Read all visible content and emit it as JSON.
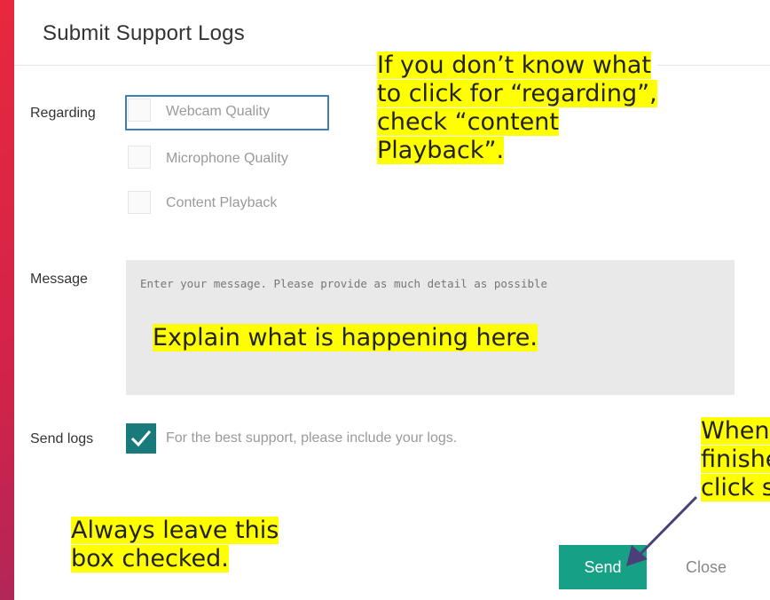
{
  "dialog": {
    "title": "Submit Support Logs",
    "regarding_label": "Regarding",
    "options": [
      {
        "label": "Webcam Quality",
        "checked": false,
        "focused": true
      },
      {
        "label": "Microphone Quality",
        "checked": false,
        "focused": false
      },
      {
        "label": "Content Playback",
        "checked": false,
        "focused": false
      }
    ],
    "message_label": "Message",
    "message_placeholder": "Enter your message. Please provide as much detail as possible",
    "message_value": "",
    "sendlogs_label": "Send logs",
    "sendlogs_text": "For the best support, please include your logs.",
    "sendlogs_checked": true,
    "send_label": "Send",
    "close_label": "Close"
  },
  "annotations": {
    "regarding_lines": [
      "If you don’t know what",
      "to click for “regarding”,",
      "check “content",
      "Playback”."
    ],
    "message_note": "Explain what is happening here.",
    "checkbox_lines": [
      "Always leave this",
      "box checked."
    ],
    "send_lines": [
      "When",
      "finishe",
      "click se"
    ]
  },
  "colors": {
    "accent": "#16a085",
    "checkbox_checked": "#187a7a",
    "focus_border": "#3c7fb7",
    "highlight": "#ffff00",
    "background_gradient_start": "#e8283e"
  }
}
